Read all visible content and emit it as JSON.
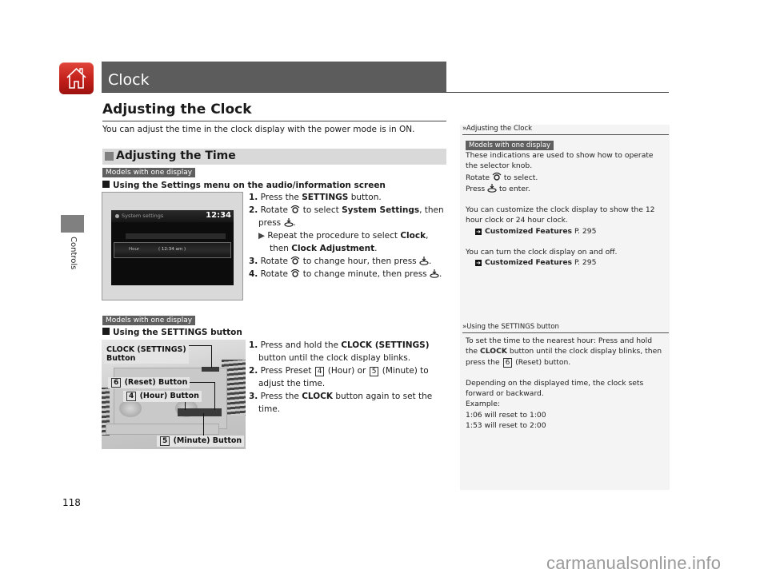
{
  "header": {
    "chapter_title": "Clock",
    "side_tab_label": "Controls"
  },
  "section": {
    "title": "Adjusting the Clock",
    "intro": "You can adjust the time in the clock display with the power mode is in ON."
  },
  "subsection": {
    "title": "Adjusting the Time",
    "badge": "Models with one display"
  },
  "method1": {
    "title": "Using the Settings menu on the audio/information screen",
    "screen": {
      "title": "System settings",
      "time": "12:34",
      "row_label": "Hour",
      "row_value": "( 12:34 am )"
    },
    "steps": [
      {
        "num": "1.",
        "pre": "Press the ",
        "bold": "SETTINGS",
        "post": " button."
      },
      {
        "num": "2.",
        "pre": "Rotate ",
        "mid": " to select ",
        "bold": "System Settings",
        "post": ", then",
        "line2": "press ",
        "line2_end": "."
      },
      {
        "sub_pre": "Repeat the procedure to select ",
        "sub_bold1": "Clock",
        "sub_mid": ",",
        "sub_line2_pre": "then ",
        "sub_bold2": "Clock Adjustment",
        "sub_end": "."
      },
      {
        "num": "3.",
        "pre": "Rotate ",
        "post": " to change hour, then press ",
        "end": "."
      },
      {
        "num": "4.",
        "pre": "Rotate ",
        "post": " to change minute, then press ",
        "end": "."
      }
    ]
  },
  "method2": {
    "badge": "Models with one display",
    "title": "Using the SETTINGS button",
    "callouts": {
      "clock_button_line1": "CLOCK (SETTINGS)",
      "clock_button_line2": "Button",
      "reset_num": "6",
      "reset_label": "(Reset) Button",
      "hour_num": "4",
      "hour_label": "(Hour) Button",
      "minute_num": "5",
      "minute_label": "(Minute) Button"
    },
    "steps": [
      {
        "num": "1.",
        "pre": "Press and hold the ",
        "bold": "CLOCK (SETTINGS)",
        "line2": "button until the clock display blinks."
      },
      {
        "num": "2.",
        "pre": "Press Preset ",
        "box1": "4",
        "mid": " (Hour) or ",
        "box2": "5",
        "post": " (Minute) to",
        "line2": "adjust the time."
      },
      {
        "num": "3.",
        "pre": "Press the ",
        "bold": "CLOCK",
        "post": " button again to set the",
        "line2": "time."
      }
    ]
  },
  "notes": {
    "note1": {
      "heading": "Adjusting the Clock",
      "badge": "Models with one display",
      "l1": "These indications are used to show how to operate",
      "l2": "the selector knob.",
      "l3_pre": "Rotate ",
      "l3_post": " to select.",
      "l4_pre": "Press ",
      "l4_post": " to enter.",
      "p2_l1": "You can customize the clock display to show the 12",
      "p2_l2": "hour clock or 24 hour clock.",
      "ref1_bold": "Customized Features",
      "ref1_page": " P. 295",
      "p3_l1": "You can turn the clock display on and off.",
      "ref2_bold": "Customized Features",
      "ref2_page": " P. 295"
    },
    "note2": {
      "heading": "Using the SETTINGS button",
      "l1": "To set the time to the nearest hour: Press and hold",
      "l2_pre": "the ",
      "l2_bold": "CLOCK",
      "l2_post": " button until the clock display blinks, then",
      "l3_pre": "press the ",
      "l3_box": "6",
      "l3_post": " (Reset) button.",
      "p2_l1": "Depending on the displayed time, the clock sets",
      "p2_l2": "forward or backward.",
      "p2_l3": "Example:",
      "p2_l4": "1:06 will reset to 1:00",
      "p2_l5": "1:53 will reset to 2:00"
    }
  },
  "footer": {
    "page_number": "118",
    "watermark": "carmanualsonline.info"
  },
  "colors": {
    "title_bar": "#5c5c5c",
    "home_red": "#c21f1a",
    "subhead_bar": "#d9d9d9",
    "note_bg": "#f4f4f4"
  }
}
